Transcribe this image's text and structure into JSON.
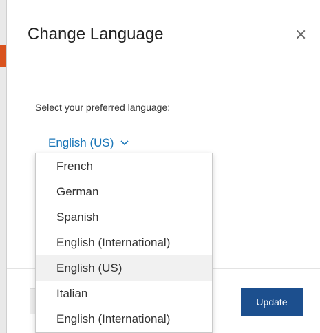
{
  "modal": {
    "title": "Change Language",
    "close_glyph": "×",
    "prompt": "Select your preferred language:",
    "selected_language": "English (US)",
    "update_label": "Update"
  },
  "dropdown": {
    "options": [
      {
        "label": "French"
      },
      {
        "label": "German"
      },
      {
        "label": "Spanish"
      },
      {
        "label": "English (International)"
      },
      {
        "label": "English (US)",
        "selected": true
      },
      {
        "label": "Italian"
      },
      {
        "label": "English (International)"
      }
    ]
  },
  "colors": {
    "accent_link": "#1a76b8",
    "primary_button": "#1c4f8e",
    "background_accent": "#d9531e"
  },
  "icons": {
    "close": "close-icon",
    "chevron": "chevron-down-icon"
  }
}
